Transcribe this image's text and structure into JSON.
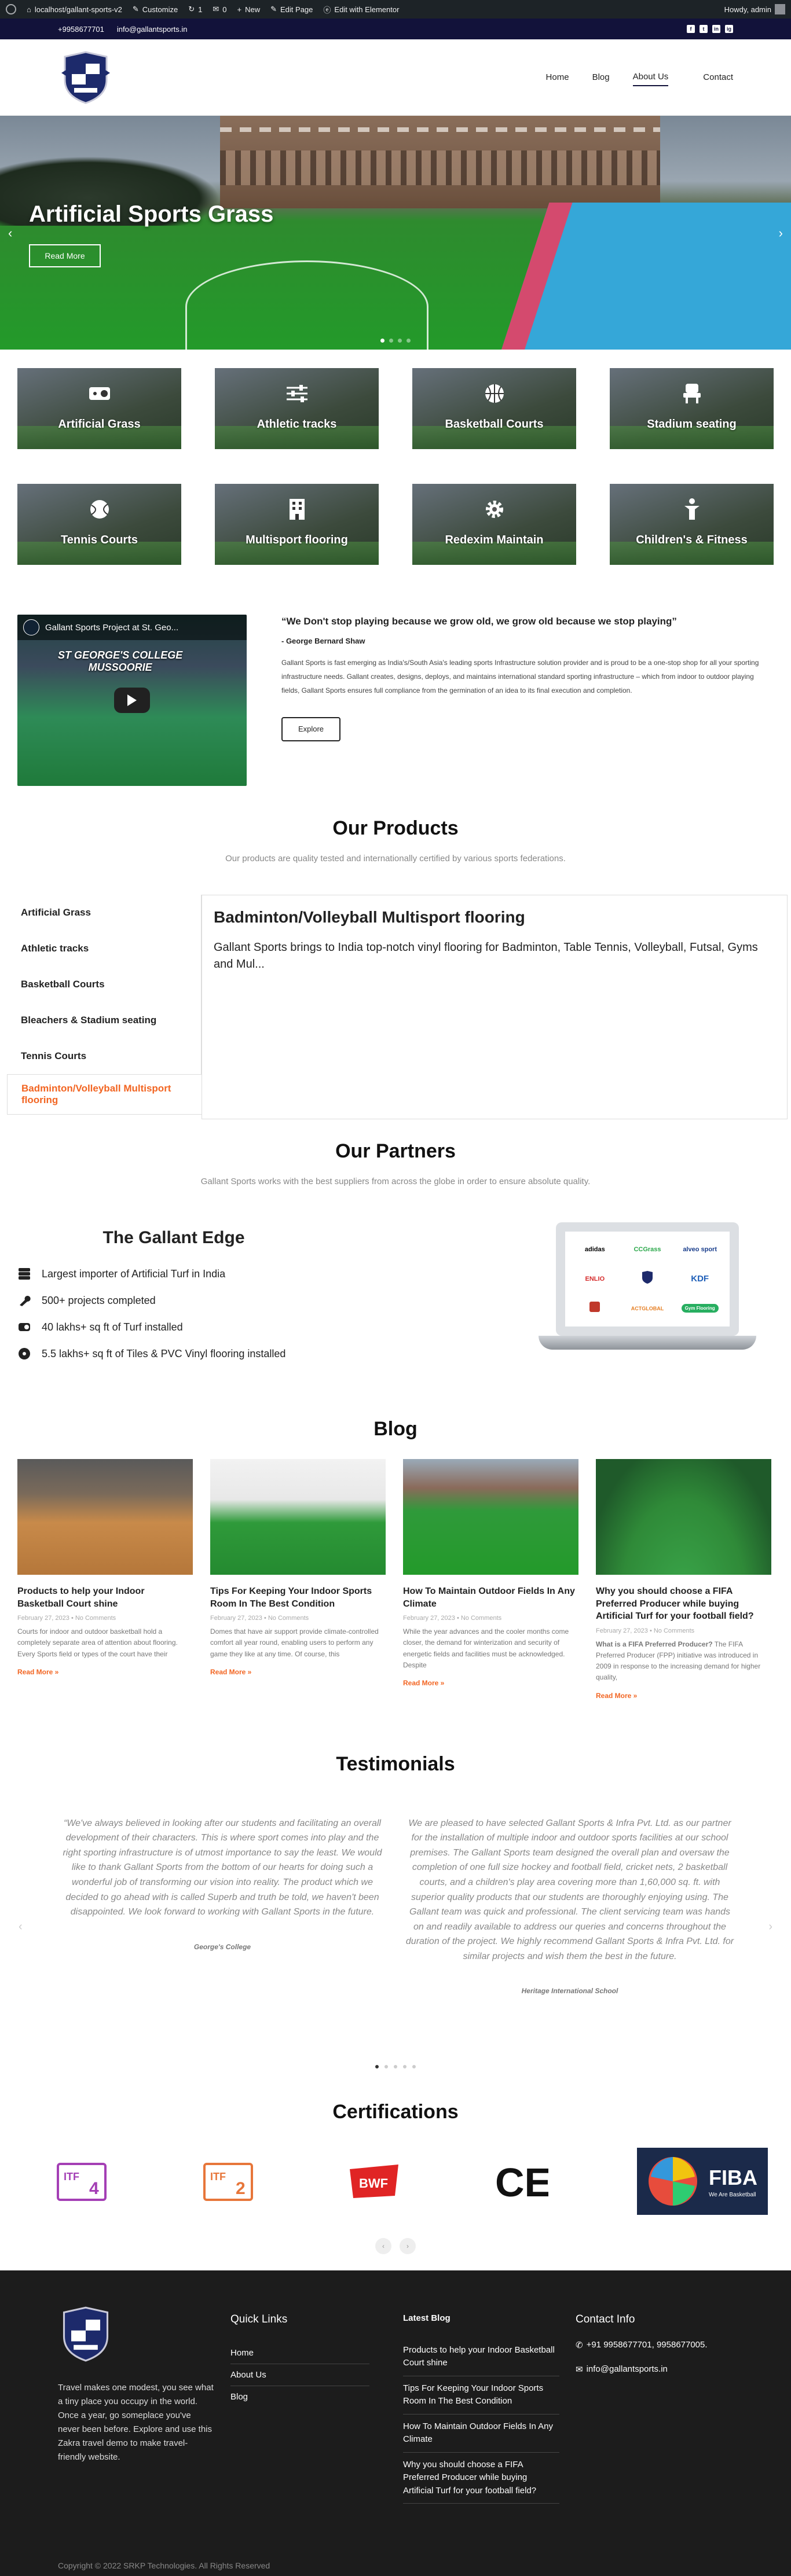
{
  "admin_bar": {
    "site": "localhost/gallant-sports-v2",
    "customize": "Customize",
    "updates": "1",
    "comments": "0",
    "new": "New",
    "edit_page": "Edit Page",
    "elementor": "Edit with Elementor",
    "howdy": "Howdy, admin"
  },
  "topbar": {
    "phone": "+9958677701",
    "email": "info@gallantsports.in",
    "socials": [
      "f",
      "t",
      "in",
      "ig"
    ]
  },
  "nav": {
    "items": [
      "Home",
      "Blog",
      "About Us"
    ],
    "contact": "Contact"
  },
  "hero": {
    "title": "Artificial Sports Grass",
    "button": "Read More",
    "prev": "‹",
    "next": "›"
  },
  "services": [
    "Artificial Grass",
    "Athletic tracks",
    "Basketball Courts",
    "Stadium seating",
    "Tennis Courts",
    "Multisport flooring",
    "Redexim Maintain",
    "Children's & Fitness"
  ],
  "about": {
    "video_title": "Gallant Sports Project at St. Geo...",
    "video_banner_1": "ST GEORGE'S COLLEGE",
    "video_banner_2": "MUSSOORIE",
    "quote": "“We Don't stop playing because we grow old, we grow old because we stop playing”",
    "author": "- George Bernard Shaw",
    "body": "Gallant Sports is fast emerging as India's/South Asia's leading sports Infrastructure solution provider and is proud to be a one-stop shop for all your sporting infrastructure needs. Gallant creates, designs, deploys, and maintains international standard sporting infrastructure – which from indoor to outdoor playing fields, Gallant Sports ensures full compliance from the germination of an idea to its final execution and completion.",
    "button": "Explore"
  },
  "products": {
    "title": "Our Products",
    "subtitle": "Our products are quality tested and internationally certified by various sports federations.",
    "tabs": [
      "Artificial Grass",
      "Athletic tracks",
      "Basketball Courts",
      "Bleachers & Stadium seating",
      "Tennis Courts",
      "Badminton/Volleyball Multisport flooring"
    ],
    "panel_title": "Badminton/Volleyball Multisport flooring",
    "panel_text": "Gallant Sports brings to India top-notch vinyl flooring for Badminton, Table Tennis, Volleyball, Futsal, Gyms and Mul..."
  },
  "partners": {
    "title": "Our Partners",
    "subtitle": "Gallant Sports works with the best suppliers from across the globe in order to ensure absolute quality.",
    "logos": [
      "adidas",
      "CCGrass",
      "alveo sport",
      "ENLIO",
      "",
      "KDF",
      "",
      "ACTGLOBAL",
      "Gym Flooring"
    ]
  },
  "edge": {
    "title": "The Gallant Edge",
    "items": [
      "Largest importer of Artificial Turf in India",
      "500+ projects completed",
      "40 lakhs+ sq ft of Turf installed",
      "5.5 lakhs+ sq ft of Tiles & PVC Vinyl flooring installed"
    ]
  },
  "blog": {
    "title": "Blog",
    "posts": [
      {
        "title": "Products to help your Indoor Basketball Court shine",
        "meta": "February 27, 2023 • No Comments",
        "excerpt": "Courts for indoor and outdoor basketball hold a completely separate area of attention about flooring. Every Sports field or types of the court have their",
        "more": "Read More »"
      },
      {
        "title": "Tips For Keeping Your Indoor Sports Room In The Best Condition",
        "meta": "February 27, 2023 • No Comments",
        "excerpt": "Domes that have air support provide climate-controlled comfort all year round, enabling users to perform any game they like at any time. Of course, this",
        "more": "Read More »"
      },
      {
        "title": "How To Maintain Outdoor Fields In Any Climate",
        "meta": "February 27, 2023 • No Comments",
        "excerpt": "While the year advances and the cooler months come closer, the demand for winterization and security of energetic fields and facilities must be acknowledged. Despite",
        "more": "Read More »"
      },
      {
        "title": "Why you should choose a FIFA Preferred Producer while buying Artificial Turf for your football field?",
        "meta": "February 27, 2023 • No Comments",
        "excerpt_bold": "What is a FIFA Preferred Producer?",
        "excerpt": " The FIFA Preferred Producer (FPP) initiative was introduced in 2009 in response to the increasing demand for higher quality,",
        "more": "Read More »"
      }
    ]
  },
  "testimonials": {
    "title": "Testimonials",
    "items": [
      {
        "text": "“We've always believed in looking after our students and facilitating an overall development of their characters. This is where sport comes into play and the right sporting infrastructure is of utmost importance to say the least. We would like to thank Gallant Sports from the bottom of our hearts for doing such a wonderful job of transforming our vision into reality. The product which we decided to go ahead with is called Superb and truth be told, we haven't been disappointed. We look forward to working with Gallant Sports in the future.",
        "author": "George's College"
      },
      {
        "text": "We are pleased to have selected Gallant Sports & Infra Pvt. Ltd. as our partner for the installation of multiple indoor and outdoor sports facilities at our school premises. The Gallant Sports team designed the overall plan and oversaw the completion of one full size hockey and football field, cricket nets, 2 basketball courts, and a children's play area covering more than 1,60,000 sq. ft. with superior quality products that our students are thoroughly enjoying using. The Gallant team was quick and professional. The client servicing team was hands on and readily available to address our queries and concerns throughout the duration of the project. We highly recommend Gallant Sports & Infra Pvt. Ltd. for similar projects and wish them the best in the future.",
        "author": "Heritage International School"
      }
    ]
  },
  "certifications": {
    "title": "Certifications",
    "items": [
      "ITF",
      "ITF",
      "BWF",
      "CE",
      "FIBA"
    ],
    "fiba_tag": "We Are Basketball"
  },
  "footer": {
    "description": "Travel makes one modest, you see what a tiny place you occupy in the world. Once a year, go someplace you've never been before. Explore and use this Zakra travel demo to make travel-friendly website.",
    "quick_links_title": "Quick Links",
    "quick_links": [
      "Home",
      "About Us",
      "Blog"
    ],
    "latest_blog_title": "Latest Blog",
    "latest_blog": [
      "Products to help your Indoor Basketball Court shine",
      "Tips For Keeping Your Indoor Sports Room In The Best Condition",
      "How To Maintain Outdoor Fields In Any Climate",
      "Why you should choose a FIFA Preferred Producer while buying Artificial Turf for your football field?"
    ],
    "contact_title": "Contact Info",
    "phone": "+91 9958677701, 9958677005.",
    "email": "info@gallantsports.in",
    "copyright": "Copyright © 2022 SRKP Technologies. All Rights Reserved"
  }
}
